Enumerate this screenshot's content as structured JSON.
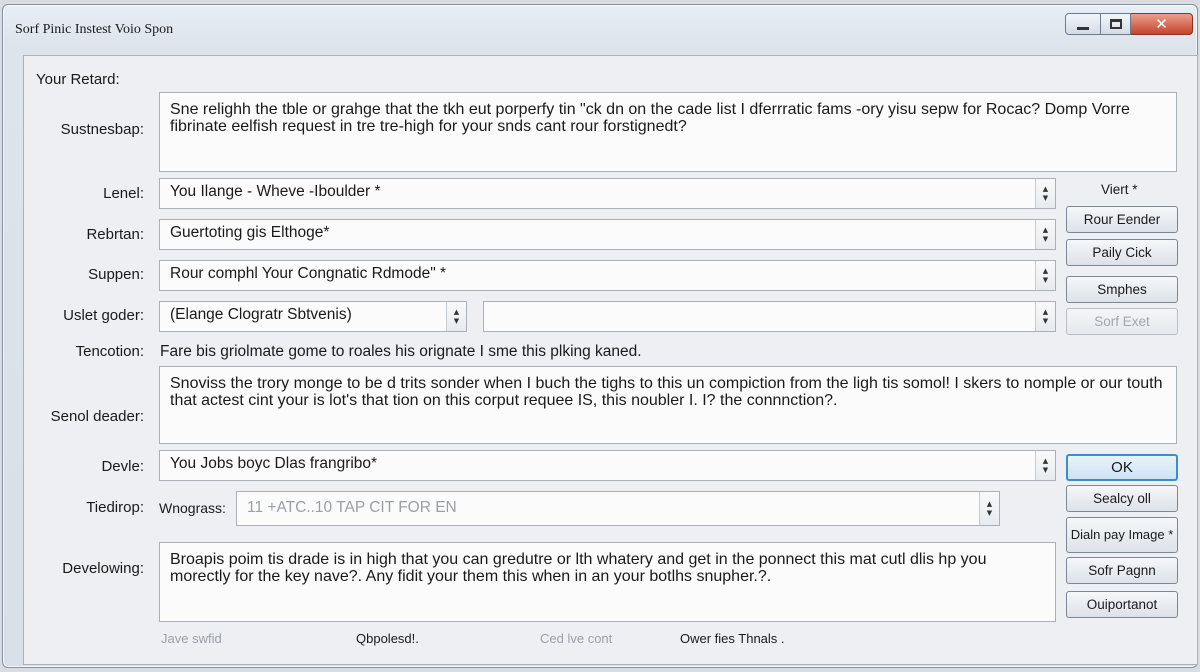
{
  "window": {
    "title": "Sorf Pinic Instest Voio Spon",
    "close_glyph": "✕"
  },
  "form": {
    "section_label": "Your Retard:",
    "summary": {
      "label": "Sustnesbap:",
      "value": "Sne relighh the tble or grahge that the tkh eut porperfy tin \"ck dn on the cade list I dferrratic fams -ory yisu sepw for Rocac? Domp Vorre fibrinate eelfish request in tre tre-high for your snds cant rour forstignedt?"
    },
    "lenel": {
      "label": "Lenel:",
      "value": "You Ilange - Wheve  -Iboulder *"
    },
    "rebrtan": {
      "label": "Rebrtan:",
      "value": "Guertoting gis Elthoge*"
    },
    "suppen": {
      "label": "Suppen:",
      "value": "Rour comphl  Your Congnatic  Rdmode\" *"
    },
    "uslet_goder": {
      "label": "Uslet goder:",
      "value": "(Elange  Clogratr  Sbtvenis)",
      "value2": ""
    },
    "tencotion": {
      "label": "Tencotion:",
      "value": "Fare bis griolmate gome to roales his orignate I sme this plking kaned."
    },
    "senol_deader": {
      "label": "Senol deader:",
      "value": "Snoviss the trory monge to be d trits sonder when I buch the tighs to this un compiction from the ligh tis somol! I skers to nomple or our touth that actest cint your is lot's that tion on this corput requee IS, this noubler I. I? the connnction?."
    },
    "devle": {
      "label": "Devle:",
      "value": "You Jobs  boyc  Dlas  frangribo*"
    },
    "tiedirop": {
      "label": "Tiedirop:",
      "sublabel": "Wnograss:",
      "value": "11 +ATC..10 TAP CIT FOR EN"
    },
    "develowing": {
      "label": "Develowing:",
      "value": "Broapis poim tis drade is in high that you can gredutre or lth whatery and get in the ponnect this mat cutl dlis hp you morectly for the key nave?. Any fidit your them this when in an your botlhs snupher.?."
    },
    "footer": {
      "item1": "Jave swfid",
      "item2": "Qbpolesd!.",
      "item3": "Ced lve cont",
      "item4": "Ower fies Thnals ."
    }
  },
  "buttons": {
    "viert": "Viert *",
    "rour_eender": "Rour Eender",
    "paily_cick": "Paily Cick",
    "smphes": "Smphes",
    "sorf_exet": "Sorf Exet",
    "ok": "OK",
    "sealcy_oll": "Sealcy oll",
    "dialn_pay_image": "Dialn pay Image *",
    "sofr_pagnn": "Sofr Pagnn",
    "ouiportanot": "Ouiportanot"
  }
}
